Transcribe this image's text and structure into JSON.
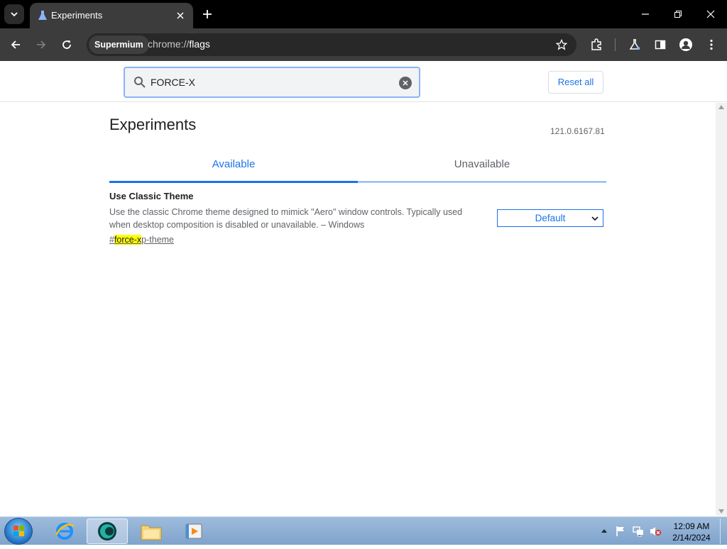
{
  "browser": {
    "tab": {
      "title": "Experiments"
    },
    "omnibox": {
      "chip": "Supermium",
      "url_prefix": "chrome://",
      "url_host": "flags"
    }
  },
  "flags": {
    "search": {
      "value": "FORCE-X"
    },
    "reset_label": "Reset all",
    "page_title": "Experiments",
    "version": "121.0.6167.81",
    "tabs": [
      {
        "label": "Available"
      },
      {
        "label": "Unavailable"
      }
    ],
    "experiments": [
      {
        "name": "Use Classic Theme",
        "description": "Use the classic Chrome theme designed to mimick \"Aero\" window controls. Typically used when desktop composition is disabled or unavailable. – Windows",
        "link_prefix": "#",
        "link_match": "force-x",
        "link_rest": "p-theme",
        "selected": "Default"
      }
    ]
  },
  "taskbar": {
    "time": "12:09 AM",
    "date": "2/14/2024"
  }
}
